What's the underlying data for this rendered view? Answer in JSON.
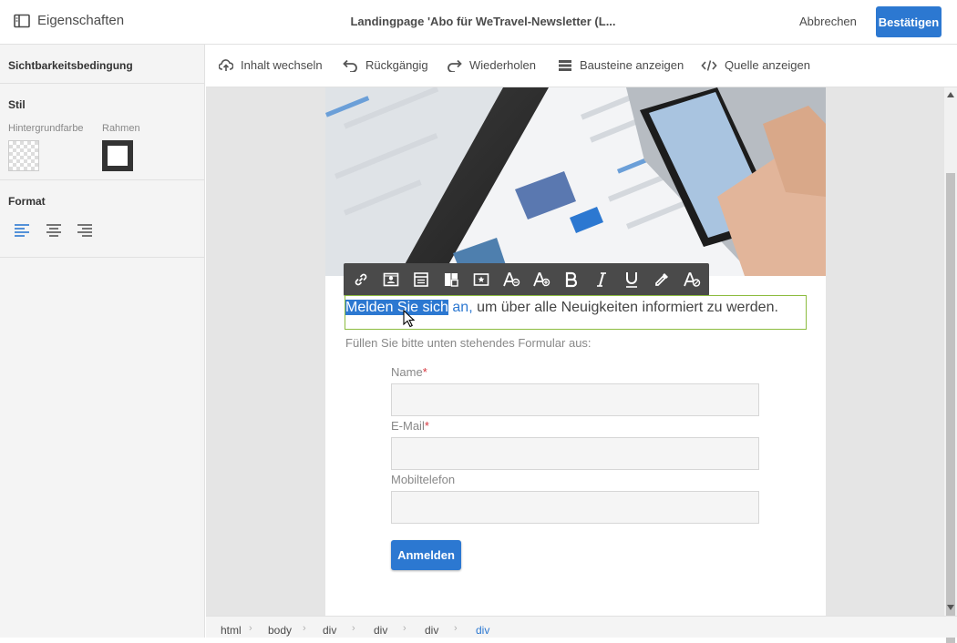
{
  "header": {
    "properties_label": "Eigenschaften",
    "title": "Landingpage 'Abo für WeTravel-Newsletter (L...",
    "cancel_label": "Abbrechen",
    "confirm_label": "Bestätigen"
  },
  "sidebar": {
    "visibility_label": "Sichtbarkeitsbedingung",
    "style_label": "Stil",
    "background_color_label": "Hintergrundfarbe",
    "border_label": "Rahmen",
    "format_label": "Format"
  },
  "toolbar": {
    "switch_content": "Inhalt wechseln",
    "undo": "Rückgängig",
    "redo": "Wiederholen",
    "show_blocks": "Bausteine anzeigen",
    "show_source": "Quelle anzeigen"
  },
  "content": {
    "headline_selected": "Melden Sie sich",
    "headline_link": " an,",
    "headline_rest": " um über alle Neuigkeiten informiert zu werden.",
    "intro": "Füllen Sie bitte unten stehendes Formular aus:",
    "form": {
      "name_label": "Name",
      "email_label": "E-Mail",
      "mobile_label": "Mobiltelefon",
      "required_mark": "*",
      "submit_label": "Anmelden"
    }
  },
  "breadcrumb": [
    "html",
    "body",
    "div",
    "div",
    "div",
    "div"
  ],
  "colors": {
    "accent": "#2c78d1",
    "edit_outline": "#8cbc3f",
    "required": "#d7373f"
  },
  "icons": {
    "format_toolbar": [
      "link-icon",
      "personalization-icon",
      "content-block-icon",
      "fragment-icon",
      "dynamic-content-icon",
      "text-color-icon",
      "background-color-icon",
      "bold-icon",
      "italic-icon",
      "underline-icon",
      "color-picker-icon",
      "clear-format-icon"
    ]
  }
}
